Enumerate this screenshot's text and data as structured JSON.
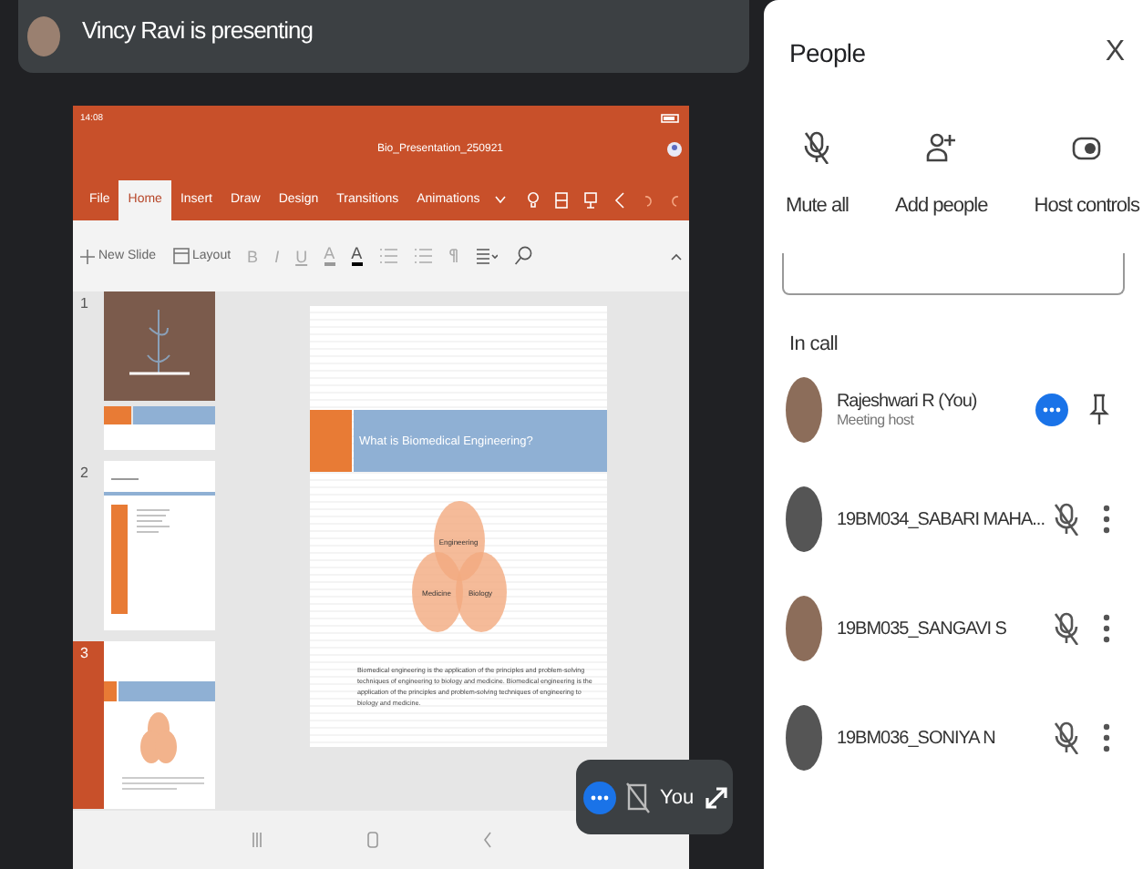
{
  "presenter_bar": {
    "title": "Vincy Ravi is presenting"
  },
  "shared_screen": {
    "status_time": "14:08",
    "document_title": "Bio_Presentation_250921",
    "ribbon_tabs": [
      {
        "label": "File",
        "selected": false
      },
      {
        "label": "Home",
        "selected": true
      },
      {
        "label": "Insert",
        "selected": false
      },
      {
        "label": "Draw",
        "selected": false
      },
      {
        "label": "Design",
        "selected": false
      },
      {
        "label": "Transitions",
        "selected": false
      },
      {
        "label": "Animations",
        "selected": false
      }
    ],
    "toolbar": {
      "new_slide": "New Slide",
      "layout": "Layout",
      "format_buttons": [
        "B",
        "I",
        "U",
        "A",
        "A"
      ]
    },
    "slides": [
      {
        "number": "1",
        "kind": "title",
        "selected": false
      },
      {
        "number": "2",
        "kind": "list",
        "selected": false
      },
      {
        "number": "3",
        "kind": "venn",
        "selected": true
      }
    ],
    "slide": {
      "title": "What is Biomedical Engineering?",
      "venn": [
        "Engineering",
        "Medicine",
        "Biology"
      ],
      "body": "Biomedical engineering is the application of the principles and problem-solving techniques of engineering to biology and medicine. Biomedical engineering is the application of the principles and problem-solving techniques of engineering to biology and medicine."
    }
  },
  "self_view": {
    "label": "You"
  },
  "people_panel": {
    "title": "People",
    "close": "X",
    "actions": [
      {
        "kind": "mute",
        "label": "Mute all"
      },
      {
        "kind": "add",
        "label": "Add people"
      },
      {
        "kind": "host",
        "label": "Host controls"
      }
    ],
    "section": "In call",
    "participants": [
      {
        "name": "Rajeshwari R (You)",
        "subtitle": "Meeting host",
        "kind": "self",
        "muted": false
      },
      {
        "name": "19BM034_SABARI MAHA...",
        "kind": "guest",
        "muted": true
      },
      {
        "name": "19BM035_SANGAVI S",
        "kind": "guest",
        "muted": true
      },
      {
        "name": "19BM036_SONIYA N",
        "kind": "guest",
        "muted": true
      }
    ]
  }
}
